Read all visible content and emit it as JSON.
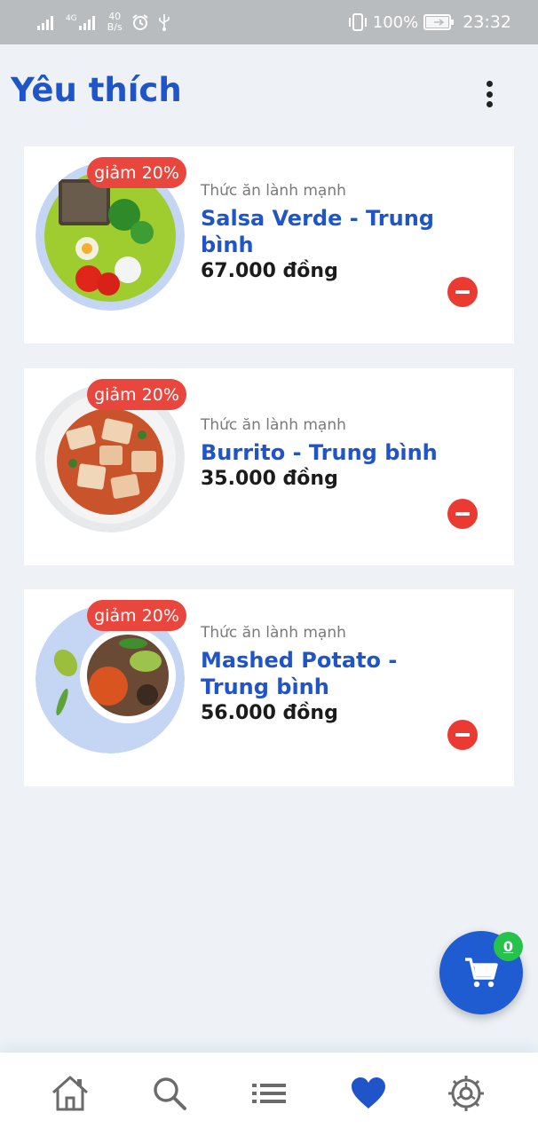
{
  "status_bar": {
    "signal_labels": [
      "4G"
    ],
    "net_speed_value": "40",
    "net_speed_unit": "B/s",
    "battery_percent": "100%",
    "time": "23:32",
    "icons": [
      "signal-icon",
      "signal-4g-icon",
      "alarm-icon",
      "usb-icon",
      "vibrate-icon",
      "battery-charging-icon"
    ]
  },
  "header": {
    "title": "Yêu thích",
    "menu_icon": "more-vertical-icon"
  },
  "favorites": [
    {
      "discount": "giảm 20%",
      "category": "Thức ăn lành mạnh",
      "name": "Salsa Verde - Trung bình",
      "price": "67.000 đồng"
    },
    {
      "discount": "giảm 20%",
      "category": "Thức ăn lành mạnh",
      "name": "Burrito - Trung bình",
      "price": "35.000 đồng"
    },
    {
      "discount": "giảm 20%",
      "category": "Thức ăn lành mạnh",
      "name": "Mashed Potato - Trung bình",
      "price": "56.000 đồng"
    }
  ],
  "cart": {
    "count": "0",
    "icon": "cart-icon"
  },
  "bottom_nav": {
    "items": [
      {
        "icon": "home-icon",
        "active": false
      },
      {
        "icon": "search-icon",
        "active": false
      },
      {
        "icon": "list-icon",
        "active": false
      },
      {
        "icon": "heart-icon",
        "active": true
      },
      {
        "icon": "settings-icon",
        "active": false
      }
    ]
  },
  "colors": {
    "accent": "#1f55c9",
    "discount": "#e9463e",
    "remove": "#ea3a32",
    "cart_badge": "#27c24c",
    "inactive_icon": "#6b6b6b"
  }
}
